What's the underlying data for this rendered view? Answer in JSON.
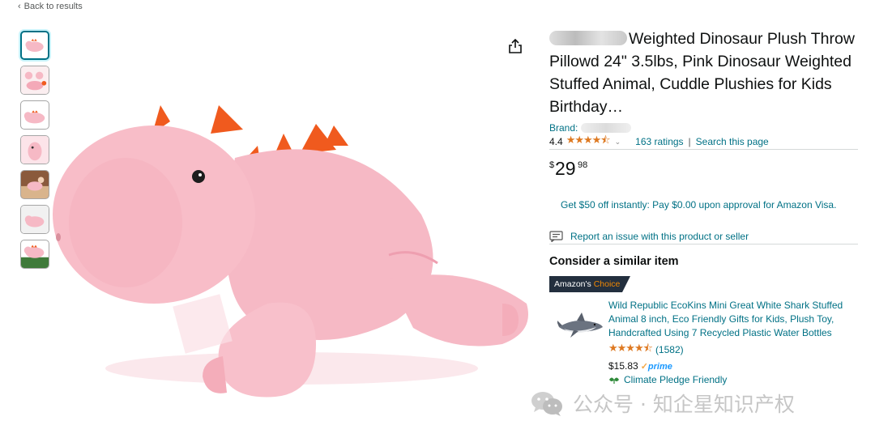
{
  "nav": {
    "back_label": "Back to results"
  },
  "product": {
    "title": "Weighted Dinosaur Plush Throw Pillowd 24\" 3.5lbs, Pink Dinosaur Weighted Stuffed Animal, Cuddle Plushies for Kids Birthday…",
    "brand_label": "Brand:",
    "rating_value": "4.4",
    "rating_stars": "★★★★⯪",
    "ratings_count": "163 ratings",
    "separator": "|",
    "search_page": "Search this page",
    "price_symbol": "$",
    "price_whole": "29",
    "price_fraction": "98"
  },
  "promo": {
    "text": "Get $50 off instantly: Pay $0.00 upon approval for Amazon Visa."
  },
  "report": {
    "text": "Report an issue with this product or seller"
  },
  "similar": {
    "heading": "Consider a similar item",
    "badge_prefix": "Amazon's",
    "badge_suffix": "Choice",
    "title": "Wild Republic EcoKins Mini Great White Shark Stuffed Animal 8 inch, Eco Friendly Gifts for Kids, Plush Toy, Handcrafted Using 7 Recycled Plastic Water Bottles",
    "stars": "★★★★⯪",
    "count": "(1582)",
    "price": "$15.83",
    "prime_tick": "✓",
    "prime_label": "prime",
    "climate": "Climate Pledge Friendly"
  },
  "watermark": {
    "text": "公众号 · 知企星知识产权"
  },
  "thumbnails": [
    {
      "name": "pink-dino-thumb-1"
    },
    {
      "name": "pink-dino-thumb-2"
    },
    {
      "name": "pink-dino-thumb-3"
    },
    {
      "name": "pink-dino-thumb-4"
    },
    {
      "name": "pink-dino-thumb-5"
    },
    {
      "name": "pink-dino-thumb-6"
    },
    {
      "name": "pink-dino-thumb-7"
    }
  ],
  "colors": {
    "link": "#007185",
    "star": "#de7921",
    "plush_pink": "#f6b9c5",
    "spike_orange": "#f05a1e",
    "badge_bg": "#232f3e",
    "badge_orange": "#f08804"
  }
}
